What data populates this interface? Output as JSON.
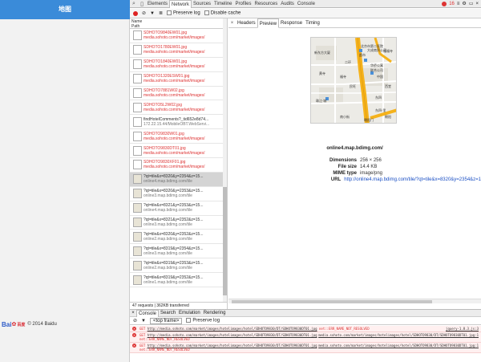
{
  "webpage": {
    "header_title": "地图",
    "footer_text": "© 2014 Baidu",
    "logo": {
      "left": "Bai",
      "right": "百度"
    }
  },
  "devtools": {
    "tabs": [
      "Elements",
      "Network",
      "Sources",
      "Timeline",
      "Profiles",
      "Resources",
      "Audits",
      "Console"
    ],
    "active_tab": "Network",
    "error_count": "16",
    "toolbar": {
      "preserve_log": "Preserve log",
      "disable_cache": "Disable cache"
    },
    "list_header": {
      "name": "Name",
      "path": "Path"
    },
    "requests": [
      {
        "name": "SDHOTO9840EW01.jpg",
        "path": "media.sohoto.com/market/images/",
        "kind": "red"
      },
      {
        "name": "SDHOTO1780EW01.jpg",
        "path": "media.sohoto.com/market/images/",
        "kind": "red"
      },
      {
        "name": "SDHOTO1840EW01.jpg",
        "path": "media.sohoto.com/market/images/",
        "kind": "red"
      },
      {
        "name": "SDHOTO1320ESW01.jpg",
        "path": "media.sohoto.com/market/images/",
        "kind": "red"
      },
      {
        "name": "SDHOTO7881W02.jpg",
        "path": "media.sohoto.com/market/images/",
        "kind": "red"
      },
      {
        "name": "SDHOTO5L2W02.jpg",
        "path": "media.sohoto.com/market/images/",
        "kind": "red"
      },
      {
        "name": "findHotelComments?_tid652e8d74...",
        "path": "172.22.15.44/MobileOBT.WebServi...",
        "kind": "normal"
      },
      {
        "name": "SDHOTO9830W01.jpg",
        "path": "media.sohoto.com/market/images/",
        "kind": "red"
      },
      {
        "name": "SDHOTO9830DT01.jpg",
        "path": "media.sohoto.com/market/images/",
        "kind": "red"
      },
      {
        "name": "SDHOTO9830XF01.jpg",
        "path": "media.sohoto.com/market/images/",
        "kind": "red"
      },
      {
        "name": "?qt=tile&x=8320&y=2354&z=15...",
        "path": "online4.map.bdimg.com/tile",
        "kind": "selected"
      },
      {
        "name": "?qt=tile&x=8320&y=2353&z=15...",
        "path": "online3.map.bdimg.com/tile",
        "kind": "map"
      },
      {
        "name": "?qt=tile&x=8321&y=2353&z=15...",
        "path": "online4.map.bdimg.com/tile",
        "kind": "map"
      },
      {
        "name": "?qt=tile&x=8321&y=2352&z=15...",
        "path": "online3.map.bdimg.com/tile",
        "kind": "map"
      },
      {
        "name": "?qt=tile&x=8320&y=2352&z=15...",
        "path": "online2.map.bdimg.com/tile",
        "kind": "map"
      },
      {
        "name": "?qt=tile&x=8319&y=2354&z=15...",
        "path": "online3.map.bdimg.com/tile",
        "kind": "map"
      },
      {
        "name": "?qt=tile&x=8319&y=2353&z=15...",
        "path": "online2.map.bdimg.com/tile",
        "kind": "map"
      },
      {
        "name": "?qt=tile&x=8319&y=2352&z=15...",
        "path": "online1.map.bdimg.com/tile",
        "kind": "map"
      }
    ],
    "status_line": "47 requests | 362KB transferred",
    "detail_tabs": [
      "Headers",
      "Preview",
      "Response",
      "Timing"
    ],
    "active_detail_tab": "Preview",
    "preview": {
      "filename": "online4.map.bdimg.com/",
      "map_labels": [
        "北京市第二医院",
        "大成商贸公司",
        "超市",
        "隆福寺",
        "中国",
        "黄寺",
        "福寺",
        "二环",
        "华侨公寓",
        "联合公司",
        "珠江·城",
        "民旺",
        "东四",
        "南小街",
        "东四·里",
        "朝阳门",
        "朝阳",
        "西堂",
        "新东方大厦"
      ],
      "metadata": [
        {
          "key": "Dimensions",
          "value": "256 × 256"
        },
        {
          "key": "File size",
          "value": "14.4 KB"
        },
        {
          "key": "MIME type",
          "value": "image/png"
        },
        {
          "key": "URL",
          "value": "http://online4.map.bdimg.com/tile/?qt=tile&x=8320&y=2354&z=1"
        }
      ]
    },
    "drawer_tabs": [
      "Console",
      "Search",
      "Emulation",
      "Rendering"
    ],
    "active_drawer_tab": "Console",
    "console_toolbar": {
      "frame": "<top frame>",
      "preserve_log": "Preserve log"
    },
    "console_messages": [
      {
        "method": "GET",
        "url": "http://media.sohoto.com/market/images/hotelimages/hotel/SDHOTO9830/DT/SDHOTO9830DT01.jpg",
        "error": "net::ERR_NAME_NOT_RESOLVED",
        "source": "jquery-1.8.3.js:3"
      },
      {
        "method": "GET",
        "url": "http://media.sohoto.com/market/images/hotelimages/hotel/SDHOTO9830/DT/SDHOTO9830DT01.jpg",
        "error": "net::ERR_NAME_NOT_RESOLVED",
        "source": "media.sohoto.com/market/images/hotelimages/hotel/SDHOTO9830/DT/SDHOTO9830DT01.jpg:1"
      },
      {
        "method": "GET",
        "url": "http://media.sohoto.com/market/images/hotelimages/hotel/SDHOTO9830/DT/SDHOTO9830DT01.jpg",
        "error": "net::ERR_NAME_NOT_RESOLVED",
        "source": "media.sohoto.com/market/images/hotelimages/hotel/SDHOTO9830/DT/SDHOTO9830DT01.jpg:1"
      }
    ]
  }
}
